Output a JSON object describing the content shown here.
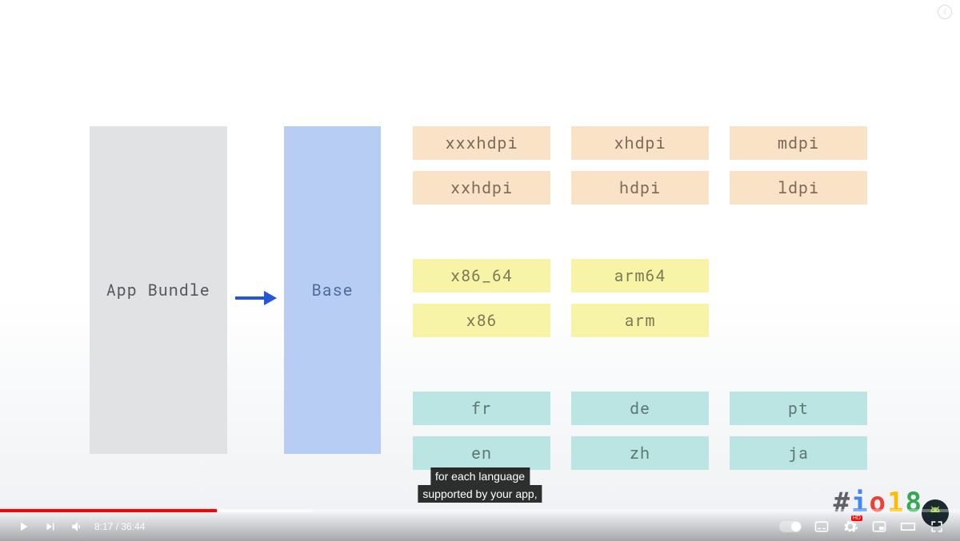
{
  "slide": {
    "bundle_label": "App Bundle",
    "base_label": "Base",
    "dpi": {
      "row1": [
        "xxxhdpi",
        "xhdpi",
        "mdpi"
      ],
      "row2": [
        "xxhdpi",
        "hdpi",
        "ldpi"
      ]
    },
    "abi": {
      "row1": [
        "x86_64",
        "arm64"
      ],
      "row2": [
        "x86",
        "arm"
      ]
    },
    "lang": {
      "row1": [
        "fr",
        "de",
        "pt"
      ],
      "row2": [
        "en",
        "zh",
        "ja"
      ]
    }
  },
  "caption": {
    "line1": "for each language",
    "line2": "supported by your app,"
  },
  "io_logo": {
    "hash": "#",
    "i": "i",
    "o": "o",
    "one": "1",
    "eight": "8"
  },
  "player": {
    "current_time": "8:17",
    "separator": " / ",
    "duration": "36:44"
  },
  "colors": {
    "progress_red": "#ff0000",
    "arrow_blue": "#2555d9"
  }
}
